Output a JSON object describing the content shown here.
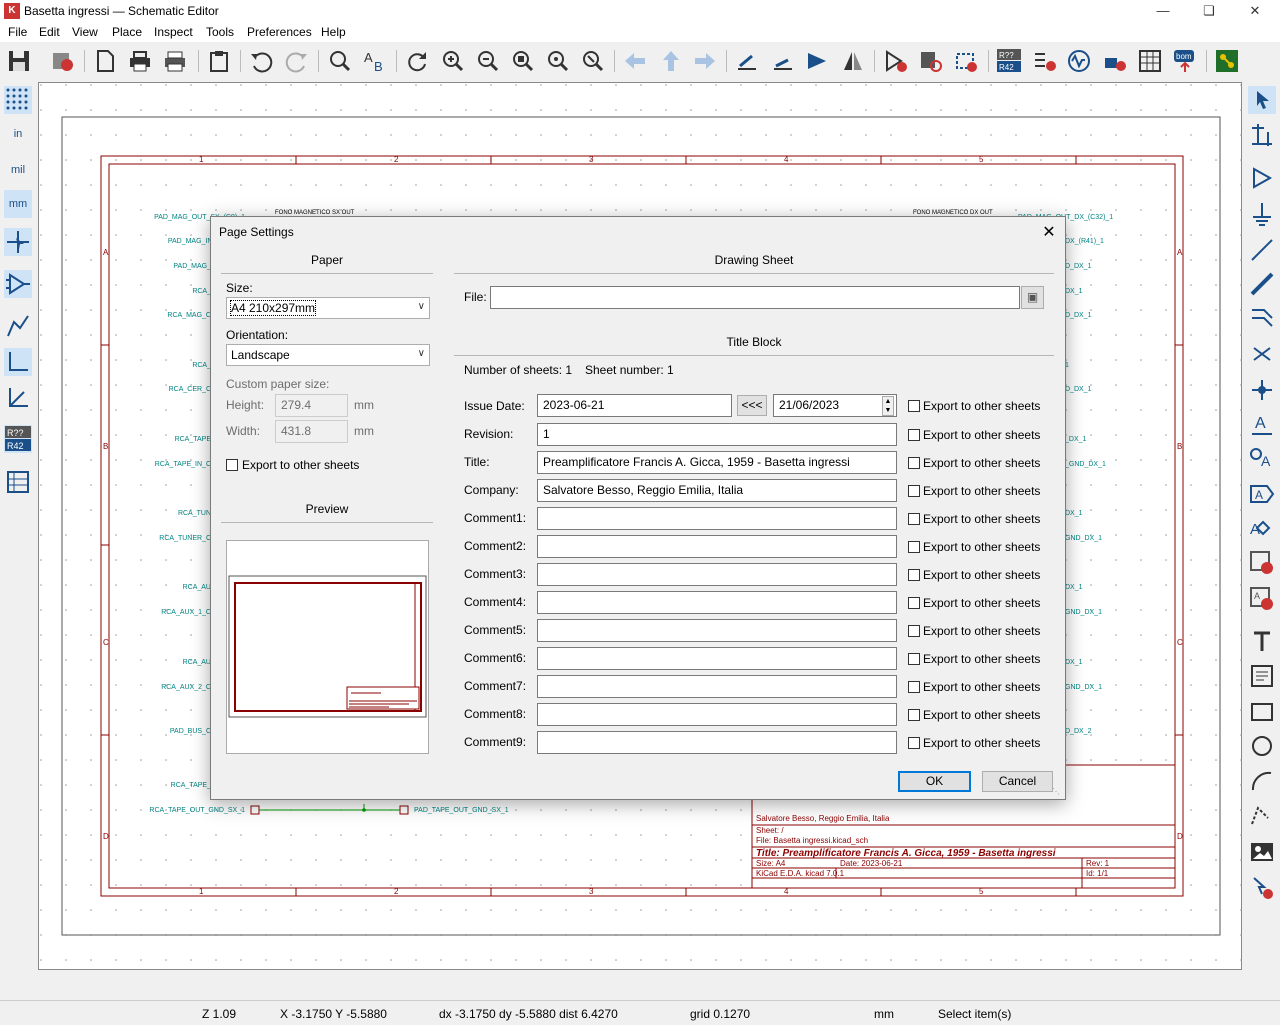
{
  "window": {
    "title": "Basetta ingressi — Schematic Editor"
  },
  "menu": [
    "File",
    "Edit",
    "View",
    "Place",
    "Inspect",
    "Tools",
    "Preferences",
    "Help"
  ],
  "left_toolbar": {
    "units_in": "in",
    "units_mil": "mil",
    "units_mm": "mm",
    "annotate": "R??\nR42"
  },
  "status": {
    "zoom": "Z 1.09",
    "xy": "X -3.1750  Y -5.5880",
    "delta": "dx -3.1750  dy -5.5880  dist 6.4270",
    "grid": "grid 0.1270",
    "units": "mm",
    "mode": "Select item(s)"
  },
  "schematic": {
    "col_numbers": [
      "1",
      "2",
      "3",
      "4",
      "5"
    ],
    "row_letters": [
      "A",
      "B",
      "C",
      "D"
    ],
    "left_labels": [
      "PAD_MAG_OUT_SX_(C9)_1",
      "PAD_MAG_IN_S",
      "PAD_MAG_",
      "RCA_",
      "RCA_MAG_C",
      "RCA_",
      "RCA_CER_C",
      "RCA_TAPE",
      "RCA_TAPE_IN_C",
      "RCA_TUN",
      "RCA_TUNER_C",
      "RCA_AU",
      "RCA_AUX_1_C",
      "RCA_AU",
      "RCA_AUX_2_C",
      "PAD_BUS_C",
      "RCA_TAPE_"
    ],
    "right_labels": [
      "PAD_MAG_OUT_DX_(C32)_1",
      "DX_(R41)_1",
      "D_DX_1",
      "DX_1",
      "D_DX_1",
      "1",
      "D_DX_1",
      "_DX_1",
      "_GND_DX_1",
      "DX_1",
      "GND_DX_1",
      "DX_1",
      "GND_DX_1",
      "DX_1",
      "GND_DX_1",
      "D_DX_2"
    ],
    "top_net_left": "FONO MAGNETICO SX OUT",
    "top_net_right": "FONO MAGNETICO DX OUT",
    "bottom_left_label": "RCA_TAPE_OUT_GND_SX_1",
    "bottom_right_label": "PAD_TAPE_OUT_GND_SX_1",
    "tb_company": "Salvatore Besso, Reggio Emilia, Italia",
    "tb_sheet": "Sheet: /",
    "tb_file": "File: Basetta ingressi.kicad_sch",
    "tb_title": "Title: Preamplificatore Francis A. Gicca, 1959 - Basetta ingressi",
    "tb_size": "Size: A4",
    "tb_date": "Date: 2023-06-21",
    "tb_rev": "Rev: 1",
    "tb_kicad": "KiCad E.D.A.  kicad 7.0.1",
    "tb_id": "Id: 1/1"
  },
  "dialog": {
    "title": "Page Settings",
    "paper_header": "Paper",
    "size_label": "Size:",
    "size_value": "A4 210x297mm",
    "orientation_label": "Orientation:",
    "orientation_value": "Landscape",
    "custom_label": "Custom paper size:",
    "height_label": "Height:",
    "height_value": "279.4",
    "height_unit": "mm",
    "width_label": "Width:",
    "width_value": "431.8",
    "width_unit": "mm",
    "paper_export_label": "Export to other sheets",
    "preview_header": "Preview",
    "drawing_sheet_header": "Drawing Sheet",
    "file_label": "File:",
    "file_value": "",
    "title_block_header": "Title Block",
    "num_sheets": "Number of sheets: 1",
    "sheet_number": "Sheet number: 1",
    "issue_date_label": "Issue Date:",
    "issue_date_value": "2023-06-21",
    "date_copy_button": "<<<",
    "date_picker_value": "21/06/2023",
    "export_label": "Export to other sheets",
    "fields": [
      {
        "label": "Revision:",
        "value": "1"
      },
      {
        "label": "Title:",
        "value": "Preamplificatore Francis A. Gicca, 1959 - Basetta ingressi"
      },
      {
        "label": "Company:",
        "value": "Salvatore Besso, Reggio Emilia, Italia"
      },
      {
        "label": "Comment1:",
        "value": ""
      },
      {
        "label": "Comment2:",
        "value": ""
      },
      {
        "label": "Comment3:",
        "value": ""
      },
      {
        "label": "Comment4:",
        "value": ""
      },
      {
        "label": "Comment5:",
        "value": ""
      },
      {
        "label": "Comment6:",
        "value": ""
      },
      {
        "label": "Comment7:",
        "value": ""
      },
      {
        "label": "Comment8:",
        "value": ""
      },
      {
        "label": "Comment9:",
        "value": ""
      }
    ],
    "ok_label": "OK",
    "cancel_label": "Cancel"
  },
  "colors": {
    "sheet_border": "#8b0000",
    "net_label": "#008484",
    "wire": "#009900",
    "tool_blue": "#1a4f8a"
  }
}
